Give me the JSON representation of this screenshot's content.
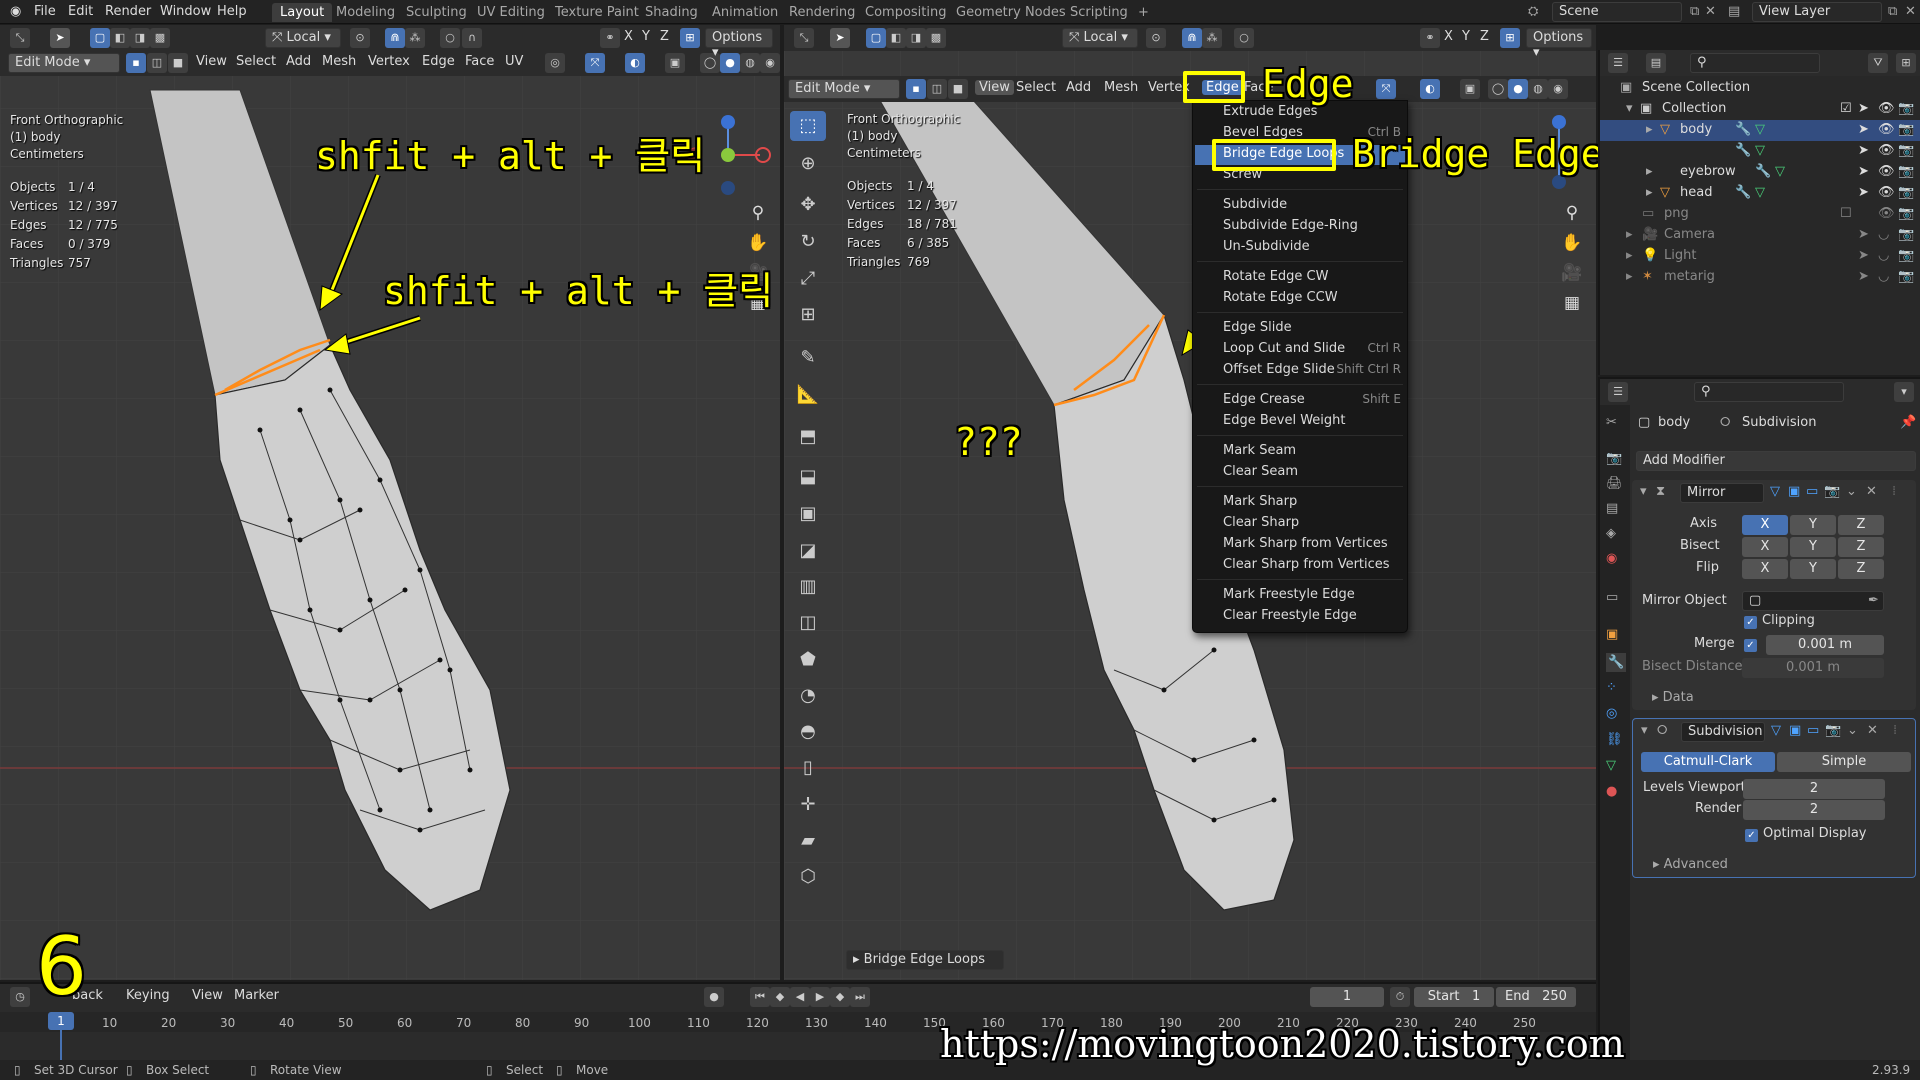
{
  "topbar": {
    "menus": [
      "File",
      "Edit",
      "Render",
      "Window",
      "Help"
    ],
    "workspaces": [
      "Layout",
      "Modeling",
      "Sculpting",
      "UV Editing",
      "Texture Paint",
      "Shading",
      "Animation",
      "Rendering",
      "Compositing",
      "Geometry Nodes",
      "Scripting"
    ],
    "active_workspace": "Layout",
    "add_tab": "+",
    "scene": "Scene",
    "view_layer": "View Layer"
  },
  "left_view": {
    "mode": "Edit Mode",
    "menus": [
      "View",
      "Select",
      "Add",
      "Mesh",
      "Vertex",
      "Edge",
      "Face",
      "UV"
    ],
    "transform_space": "Local",
    "axes": [
      "X",
      "Y",
      "Z"
    ],
    "options": "Options",
    "overlay": [
      "Front Orthographic",
      "(1) body",
      "Centimeters"
    ],
    "stats": [
      {
        "label": "Objects",
        "value": "1 / 4"
      },
      {
        "label": "Vertices",
        "value": "12 / 397"
      },
      {
        "label": "Edges",
        "value": "12 / 775"
      },
      {
        "label": "Faces",
        "value": "0 / 379"
      },
      {
        "label": "Triangles",
        "value": "757"
      }
    ]
  },
  "right_view": {
    "mode": "Edit Mode",
    "menus": [
      "View",
      "Select",
      "Add",
      "Mesh",
      "Vertex",
      "Edge",
      "Face"
    ],
    "transform_space": "Local",
    "axes": [
      "X",
      "Y",
      "Z"
    ],
    "options": "Options",
    "overlay": [
      "Front Orthographic",
      "(1) body",
      "Centimeters"
    ],
    "stats": [
      {
        "label": "Objects",
        "value": "1 / 4"
      },
      {
        "label": "Vertices",
        "value": "12 / 397"
      },
      {
        "label": "Edges",
        "value": "18 / 781"
      },
      {
        "label": "Faces",
        "value": "6 / 385"
      },
      {
        "label": "Triangles",
        "value": "769"
      }
    ],
    "last_operator": "Bridge Edge Loops"
  },
  "annotations": {
    "click1": "shfit + alt + 클릭",
    "click2": "shfit + alt + 클릭",
    "edge_label": "Edge",
    "bridge_label": "Bridge Edge Loops",
    "question": "???",
    "step": "6",
    "url": "https://movingtoon2020.tistory.com"
  },
  "edge_menu": {
    "items": [
      {
        "label": "Extrude Edges",
        "shortcut": ""
      },
      {
        "label": "Bevel Edges",
        "shortcut": "Ctrl B"
      },
      {
        "label": "Bridge Edge Loops",
        "shortcut": "",
        "highlight": true
      },
      {
        "label": "Screw",
        "shortcut": ""
      },
      {
        "label": "Subdivide",
        "shortcut": ""
      },
      {
        "label": "Subdivide Edge-Ring",
        "shortcut": ""
      },
      {
        "label": "Un-Subdivide",
        "shortcut": ""
      },
      {
        "label": "Rotate Edge CW",
        "shortcut": ""
      },
      {
        "label": "Rotate Edge CCW",
        "shortcut": ""
      },
      {
        "label": "Edge Slide",
        "shortcut": ""
      },
      {
        "label": "Loop Cut and Slide",
        "shortcut": "Ctrl R"
      },
      {
        "label": "Offset Edge Slide",
        "shortcut": "Shift Ctrl R"
      },
      {
        "label": "Edge Crease",
        "shortcut": "Shift E"
      },
      {
        "label": "Edge Bevel Weight",
        "shortcut": ""
      },
      {
        "label": "Mark Seam",
        "shortcut": ""
      },
      {
        "label": "Clear Seam",
        "shortcut": ""
      },
      {
        "label": "Mark Sharp",
        "shortcut": ""
      },
      {
        "label": "Clear Sharp",
        "shortcut": ""
      },
      {
        "label": "Mark Sharp from Vertices",
        "shortcut": ""
      },
      {
        "label": "Clear Sharp from Vertices",
        "shortcut": ""
      },
      {
        "label": "Mark Freestyle Edge",
        "shortcut": ""
      },
      {
        "label": "Clear Freestyle Edge",
        "shortcut": ""
      }
    ]
  },
  "outliner": {
    "items": [
      {
        "label": "Scene Collection",
        "icon": "collection-icon"
      },
      {
        "label": "Collection",
        "icon": "collection-icon"
      },
      {
        "label": "body",
        "icon": "mesh-icon",
        "selected": true
      },
      {
        "label": "eyebrow",
        "icon": "mesh-icon"
      },
      {
        "label": "head",
        "icon": "mesh-icon"
      },
      {
        "label": "png",
        "icon": "image-icon"
      },
      {
        "label": "Camera",
        "icon": "camera-icon"
      },
      {
        "label": "Light",
        "icon": "light-icon"
      },
      {
        "label": "metarig",
        "icon": "armature-icon"
      }
    ]
  },
  "properties": {
    "object": "body",
    "modifier_name": "Subdivision",
    "add_modifier": "Add Modifier",
    "mirror": {
      "name": "Mirror",
      "axis_label": "Axis",
      "bisect_label": "Bisect",
      "flip_label": "Flip",
      "xyz": [
        "X",
        "Y",
        "Z"
      ],
      "mirror_object_label": "Mirror Object",
      "clipping": "Clipping",
      "merge_label": "Merge",
      "merge_value": "0.001 m",
      "bisect_distance_label": "Bisect Distance",
      "bisect_distance_value": "0.001 m",
      "data": "Data"
    },
    "subdivision": {
      "name": "Subdivision",
      "catmull": "Catmull-Clark",
      "simple": "Simple",
      "levels_viewport_label": "Levels Viewport",
      "levels_viewport": "2",
      "render_label": "Render",
      "render": "2",
      "optimal_display": "Optimal Display",
      "advanced": "Advanced"
    }
  },
  "timeline": {
    "playback": "back",
    "keying": "Keying",
    "view": "View",
    "marker": "Marker",
    "current_frame": "1",
    "start_label": "Start",
    "start": "1",
    "end_label": "End",
    "end": "250",
    "ticks": [
      "1",
      "10",
      "20",
      "30",
      "40",
      "50",
      "60",
      "70",
      "80",
      "90",
      "100",
      "110",
      "120",
      "130",
      "140",
      "150",
      "160",
      "170",
      "180",
      "190",
      "200",
      "210",
      "220",
      "230",
      "240",
      "250"
    ]
  },
  "statusbar": {
    "items": [
      "Set 3D Cursor",
      "Box Select",
      "Rotate View",
      "Select",
      "Move"
    ],
    "version": "2.93.9"
  },
  "colors": {
    "accent": "#4772b3",
    "annotation_yellow": "#ffff00",
    "selection_orange": "#ff8c1a"
  }
}
